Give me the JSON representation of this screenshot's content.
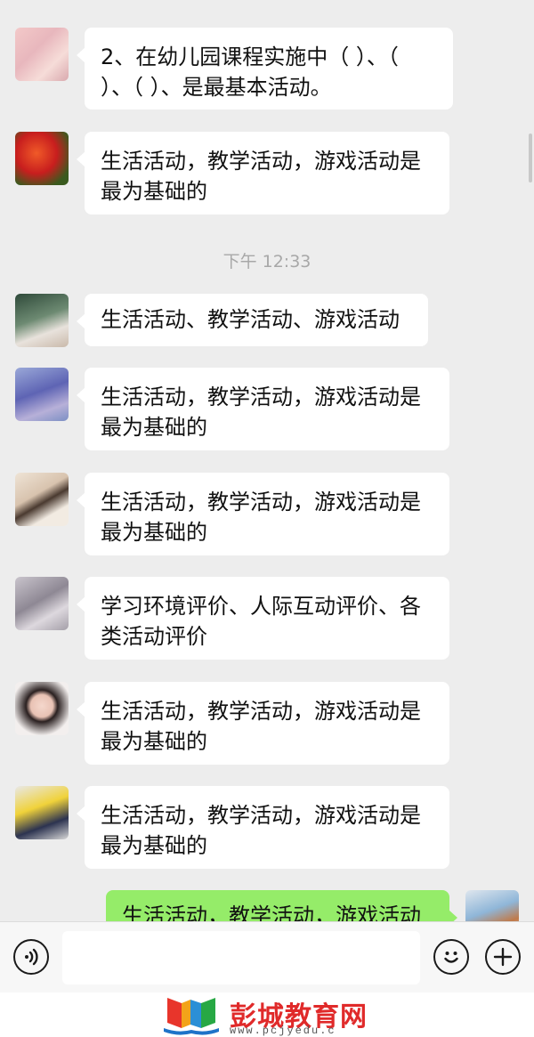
{
  "chat": {
    "messages": [
      {
        "id": "m1",
        "text": "2、在幼儿园课程实施中（ ）、（ ）、（ ）、是最基本活动。"
      },
      {
        "id": "m2",
        "text": "生活活动，教学活动，游戏活动是最为基础的"
      },
      {
        "id": "m3",
        "text": "生活活动、教学活动、游戏活动"
      },
      {
        "id": "m4",
        "text": "生活活动，教学活动，游戏活动是最为基础的"
      },
      {
        "id": "m5",
        "text": "生活活动，教学活动，游戏活动是最为基础的"
      },
      {
        "id": "m6",
        "text": "学习环境评价、人际互动评价、各类活动评价"
      },
      {
        "id": "m7",
        "text": "生活活动，教学活动，游戏活动是最为基础的"
      },
      {
        "id": "m8",
        "text": "生活活动，教学活动，游戏活动是最为基础的"
      },
      {
        "id": "m9",
        "text": "生活活动，教学活动，游戏活动"
      }
    ],
    "timestamp": "下午 12:33"
  },
  "lines": {
    "m1": [
      "2、在幼儿园课程实施中（ ）、（",
      "）、（ ）、是最基本活动。"
    ],
    "m2": [
      "生活活动，教学活动，游戏活动是",
      "最为基础的"
    ],
    "m4": [
      "生活活动，教学活动，游戏活动是",
      "最为基础的"
    ],
    "m5": [
      "生活活动，教学活动，游戏活动是",
      "最为基础的"
    ],
    "m6": [
      "学习环境评价、人际互动评价、各",
      "类活动评价"
    ],
    "m7": [
      "生活活动，教学活动，游戏活动是",
      "最为基础的"
    ],
    "m8": [
      "生活活动，教学活动，游戏活动是",
      "最为基础的"
    ]
  },
  "input_bar": {
    "voice_icon": "voice-icon",
    "emoji_icon": "emoji-icon",
    "plus_icon": "plus-icon",
    "input_value": ""
  },
  "watermark": {
    "name": "彭城教育网",
    "url": "www.pcjyedu.c"
  },
  "colors": {
    "background": "#ededed",
    "bubble_other": "#ffffff",
    "bubble_mine": "#95ec69",
    "watermark_red": "#e02a2a"
  }
}
